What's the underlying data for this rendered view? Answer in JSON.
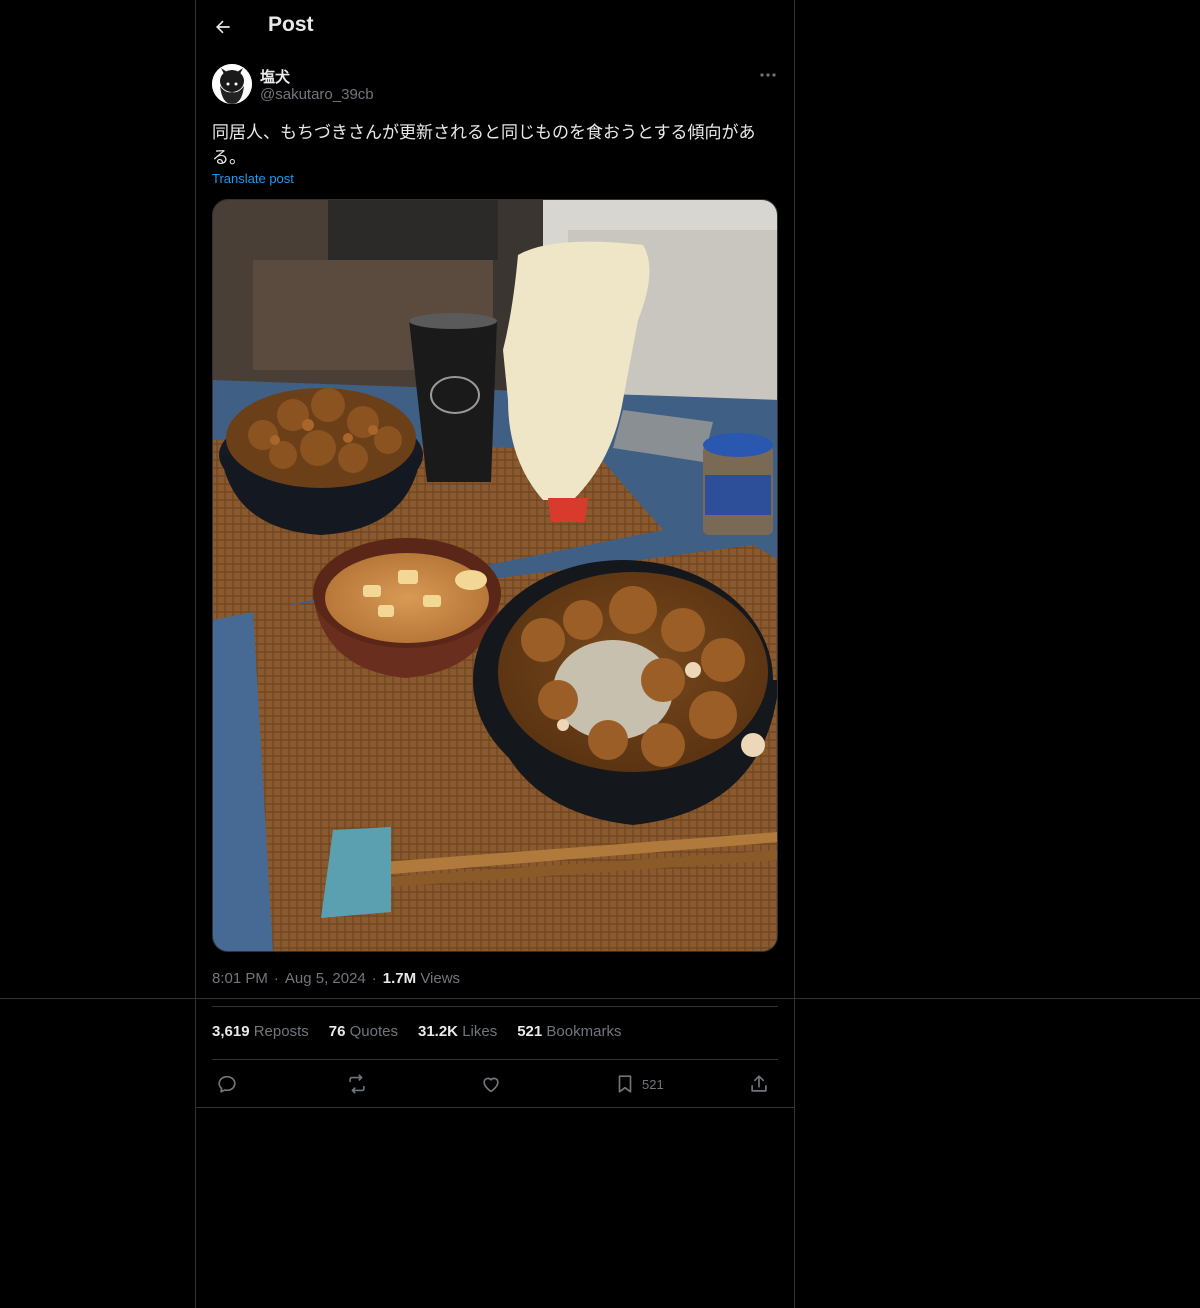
{
  "header": {
    "title": "Post"
  },
  "post": {
    "author": {
      "display_name": "塩犬",
      "handle": "@sakutaro_39cb"
    },
    "text": "同居人、もちづきさんが更新されると同じものを食おうとする傾向がある。",
    "translate_label": "Translate post",
    "time": "8:01 PM",
    "date": "Aug 5, 2024",
    "views_count": "1.7M",
    "views_label": "Views"
  },
  "stats": {
    "reposts_count": "3,619",
    "reposts_label": "Reposts",
    "quotes_count": "76",
    "quotes_label": "Quotes",
    "likes_count": "31.2K",
    "likes_label": "Likes",
    "bookmarks_count": "521",
    "bookmarks_label": "Bookmarks"
  },
  "actions": {
    "bookmark_count": "521"
  },
  "icons": [
    "back-arrow-icon",
    "more-icon",
    "reply-icon",
    "repost-icon",
    "like-icon",
    "bookmark-icon",
    "share-icon"
  ],
  "colors": {
    "background": "#000000",
    "text": "#e7e9ea",
    "secondary": "#71767b",
    "link": "#1d9bf0",
    "border": "#2f3336"
  }
}
